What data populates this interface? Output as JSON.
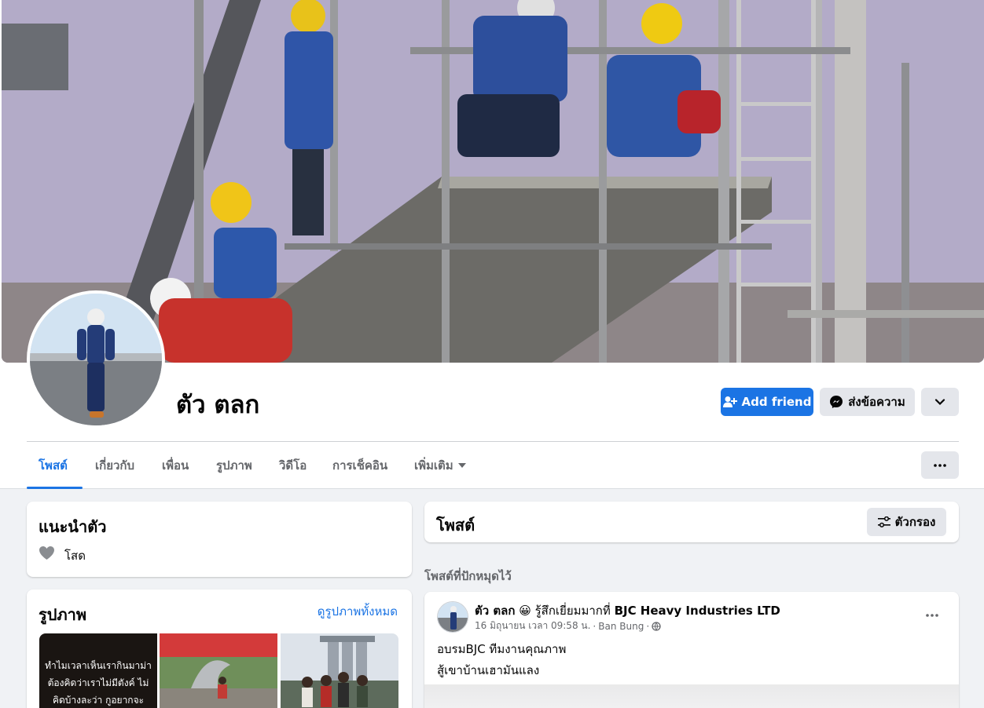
{
  "profile": {
    "name": "ตัว ตลก"
  },
  "actions": {
    "add_friend": "Add friend",
    "message": "ส่งข้อความ"
  },
  "tabs": [
    {
      "label": "โพสต์"
    },
    {
      "label": "เกี่ยวกับ"
    },
    {
      "label": "เพื่อน"
    },
    {
      "label": "รูปภาพ"
    },
    {
      "label": "วิดีโอ"
    },
    {
      "label": "การเช็คอิน"
    },
    {
      "label": "เพิ่มเติม"
    }
  ],
  "intro": {
    "title": "แนะนำตัว",
    "relationship": "โสด"
  },
  "photos": {
    "title": "รูปภาพ",
    "see_all": "ดูรูปภาพทั้งหมด",
    "thumb1_caption": "ทำไมเวลาเห็นเรากินมาม่า ต้องคิดว่าเราไม่มีตังค์ ไม่คิดบ้างละว่า กูอยากจะ"
  },
  "posts_header": {
    "title": "โพสต์",
    "filter": "ตัวกรอง"
  },
  "pinned_label": "โพสต์ที่ปักหมุดไว้",
  "post": {
    "author": "ตัว ตลก",
    "emoji": "😀",
    "feeling": "รู้สึกเยี่ยมมากที่",
    "place": "BJC Heavy Industries LTD",
    "time": "16 มิถุนายน เวลา 09:58 น.",
    "location": "Ban Bung",
    "line1": "อบรมBJC ทีมงานคุณภาพ",
    "line2": "สู้เขาบ้านเฮามันแลง"
  },
  "colors": {
    "accent": "#1b74e4",
    "background": "#f0f2f5",
    "secondary_text": "#65676b"
  },
  "icons": {
    "add_friend": "person-plus-icon",
    "messenger": "messenger-icon",
    "dropdown": "chevron-down-icon",
    "more": "ellipsis-icon",
    "relationship": "heart-icon",
    "filter": "sliders-icon",
    "privacy": "globe-icon"
  }
}
